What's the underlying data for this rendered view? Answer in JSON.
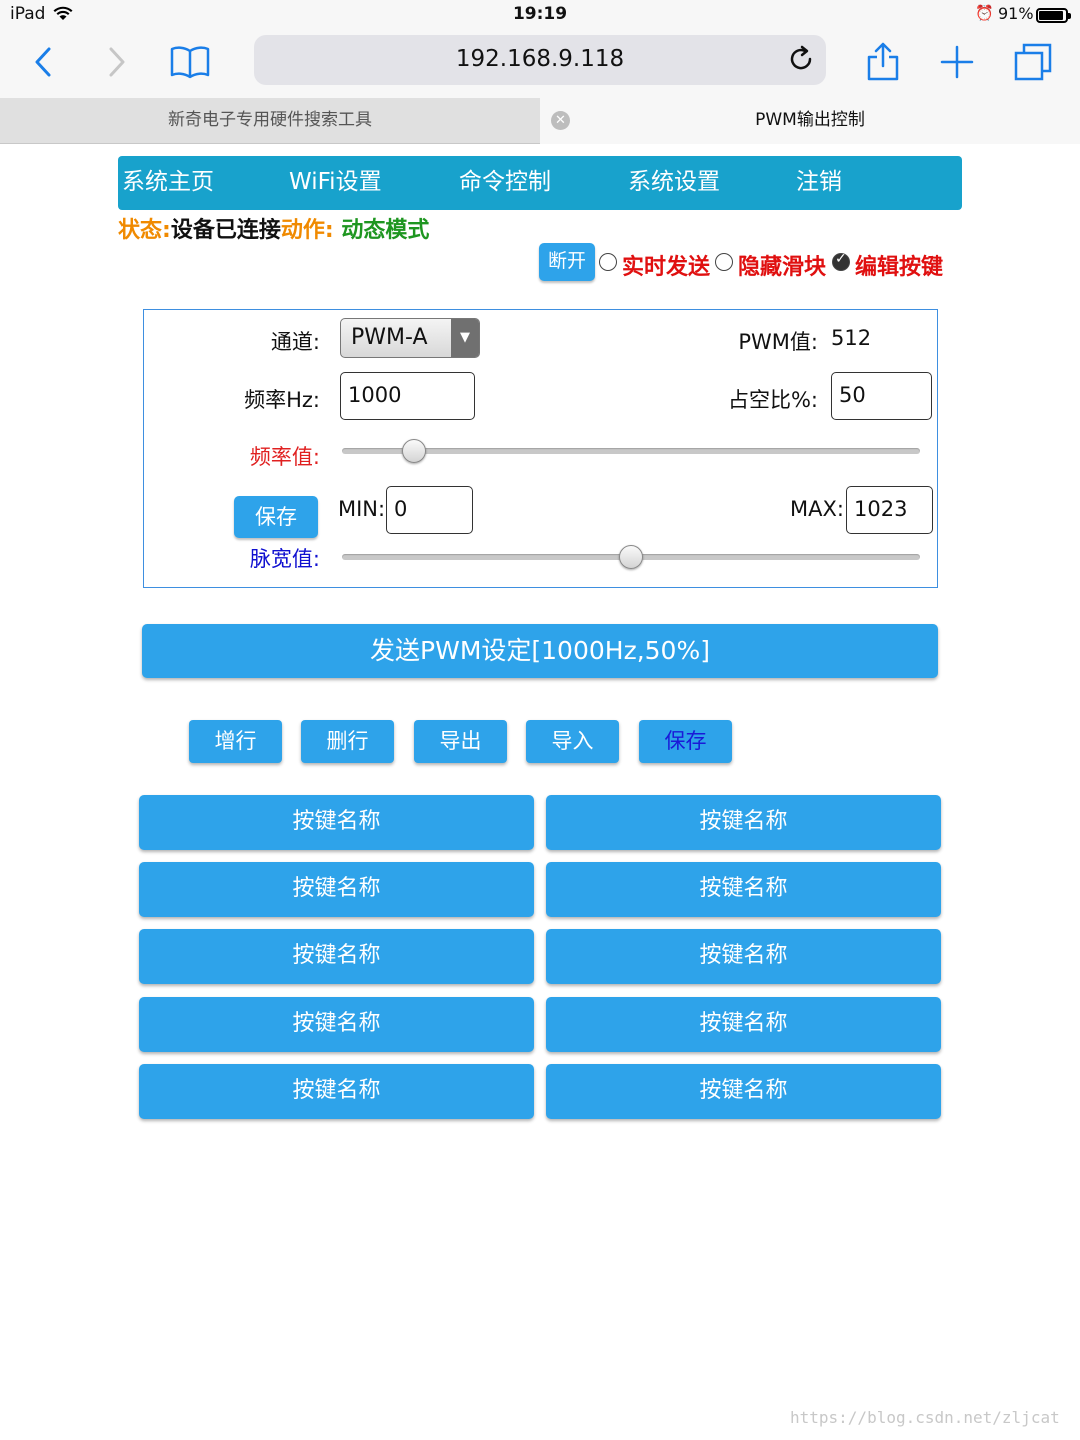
{
  "status_bar": {
    "device": "iPad",
    "time": "19:19",
    "battery_percent": "91%",
    "battery_level": 0.91
  },
  "browser": {
    "url": "192.168.9.118",
    "tabs": [
      {
        "title": "新奇电子专用硬件搜索工具",
        "active": false
      },
      {
        "title": "PWM输出控制",
        "active": true
      }
    ]
  },
  "nav": {
    "items": [
      "系统主页",
      "WiFi设置",
      "命令控制",
      "系统设置",
      "注销"
    ],
    "color": "#18a2cc"
  },
  "status_line": {
    "status_label": "状态:",
    "status_value": "设备已连接",
    "action_label": "动作:",
    "action_value": "动态模式"
  },
  "controls": {
    "disconnect_label": "断开",
    "realtime_label": "实时发送",
    "realtime_checked": false,
    "hide_slider_label": "隐藏滑块",
    "hide_slider_checked": false,
    "edit_keys_label": "编辑按键",
    "edit_keys_checked": true
  },
  "pwm_panel": {
    "channel_label": "通道:",
    "channel_value": "PWM-A",
    "pwm_value_label": "PWM值:",
    "pwm_value": "512",
    "freq_label": "频率Hz:",
    "freq_value": "1000",
    "duty_label": "占空比%:",
    "duty_value": "50",
    "freq_slider_label": "频率值:",
    "freq_slider_position": 0.124,
    "save_label": "保存",
    "min_label": "MIN:",
    "min_value": "0",
    "max_label": "MAX:",
    "max_value": "1023",
    "width_slider_label": "脉宽值:",
    "width_slider_position": 0.5
  },
  "send_button": "发送PWM设定[1000Hz,50%]",
  "row_actions": [
    "增行",
    "删行",
    "导出",
    "导入",
    "保存"
  ],
  "key_buttons": [
    "按键名称",
    "按键名称",
    "按键名称",
    "按键名称",
    "按键名称",
    "按键名称",
    "按键名称",
    "按键名称",
    "按键名称",
    "按键名称"
  ],
  "watermark": "https://blog.csdn.net/zljcat",
  "colors": {
    "button_blue": "#2ea3ea",
    "panel_border": "#3e8fe0",
    "status_orange": "#f08a00",
    "status_green": "#1e9620",
    "label_red": "#e02020",
    "label_blue": "#1010d0"
  }
}
